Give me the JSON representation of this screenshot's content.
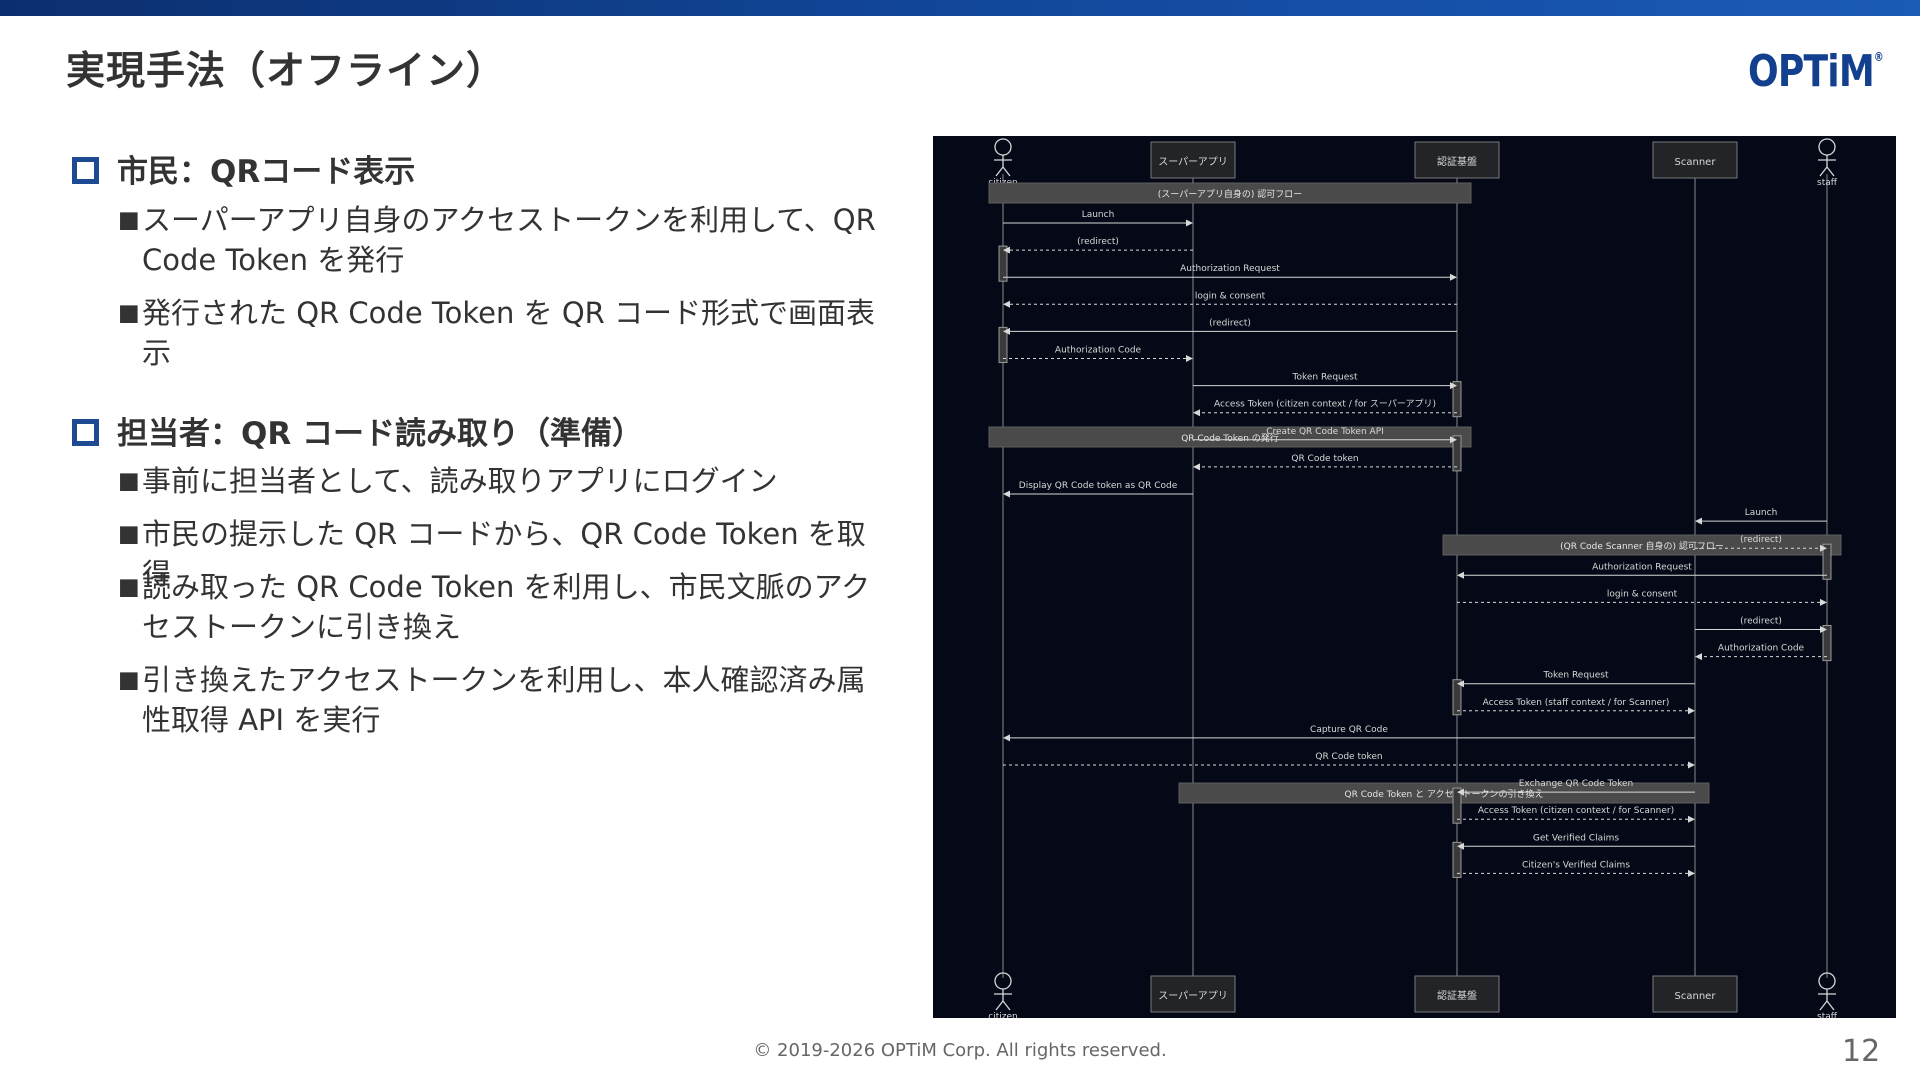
{
  "slide": {
    "title": "実現手法（オフライン）",
    "logo": "OPTiM",
    "logo_mark": "®",
    "footer": "© 2019-2026 OPTiM Corp. All rights reserved.",
    "page_number": "12",
    "accent_color": "#1d4a93"
  },
  "sections": [
    {
      "heading": "市民：QRコード表示",
      "bullets": [
        "スーパーアプリ自身のアクセストークンを利用して、QR Code Token を発行",
        "発行された QR Code Token を QR コード形式で画面表示"
      ]
    },
    {
      "heading": "担当者：QR コード読み取り（準備）",
      "bullets": [
        "事前に担当者として、読み取りアプリにログイン",
        "市民の提示した QR コードから、QR Code Token を取得",
        "読み取った QR Code Token を利用し、市民文脈のアクセストークンに引き換え",
        "引き換えたアクセストークンを利用し、本人確認済み属性取得 API を実行"
      ]
    }
  ],
  "diagram": {
    "participants": [
      {
        "key": "citizen",
        "label": "citizen",
        "kind": "actor"
      },
      {
        "key": "app",
        "label": "スーパーアプリ",
        "kind": "box"
      },
      {
        "key": "auth",
        "label": "認証基盤",
        "kind": "box"
      },
      {
        "key": "scanner",
        "label": "Scanner",
        "kind": "box"
      },
      {
        "key": "staff",
        "label": "staff",
        "kind": "actor"
      }
    ],
    "notes": [
      {
        "after": 0,
        "from": "citizen",
        "to": "auth",
        "label": "(スーパーアプリ自身の) 認可フロー"
      },
      {
        "after": 7,
        "from": "citizen",
        "to": "auth",
        "label": "QR Code Token の発行"
      },
      {
        "after": 10,
        "from": "auth",
        "to": "staff",
        "label": "(QR Code Scanner 自身の) 認可フロー"
      },
      {
        "after": 17,
        "from": "app",
        "to": "scanner",
        "label": "QR Code Token と アクセストークンの引き換え"
      }
    ],
    "messages": [
      {
        "from": "citizen",
        "to": "app",
        "label": "Launch",
        "dashed": false
      },
      {
        "from": "app",
        "to": "citizen",
        "label": "(redirect)",
        "dashed": true
      },
      {
        "from": "citizen",
        "to": "auth",
        "label": "Authorization Request",
        "dashed": false
      },
      {
        "from": "auth",
        "to": "citizen",
        "label": "login & consent",
        "dashed": true
      },
      {
        "from": "auth",
        "to": "citizen",
        "label": "(redirect)",
        "dashed": false
      },
      {
        "from": "citizen",
        "to": "app",
        "label": "Authorization Code",
        "dashed": true
      },
      {
        "from": "app",
        "to": "auth",
        "label": "Token Request",
        "dashed": false
      },
      {
        "from": "auth",
        "to": "app",
        "label": "Access Token (citizen context / for スーパーアプリ)",
        "dashed": true
      },
      {
        "from": "app",
        "to": "auth",
        "label": "Create QR Code Token API",
        "dashed": false
      },
      {
        "from": "auth",
        "to": "app",
        "label": "QR Code token",
        "dashed": true
      },
      {
        "from": "app",
        "to": "citizen",
        "label": "Display QR Code token as QR Code",
        "dashed": false
      },
      {
        "from": "staff",
        "to": "scanner",
        "label": "Launch",
        "dashed": false
      },
      {
        "from": "scanner",
        "to": "staff",
        "label": "(redirect)",
        "dashed": true
      },
      {
        "from": "staff",
        "to": "auth",
        "label": "Authorization Request",
        "dashed": false
      },
      {
        "from": "auth",
        "to": "staff",
        "label": "login & consent",
        "dashed": true
      },
      {
        "from": "scanner",
        "to": "staff",
        "label": "(redirect)",
        "dashed": false
      },
      {
        "from": "staff",
        "to": "scanner",
        "label": "Authorization Code",
        "dashed": true
      },
      {
        "from": "scanner",
        "to": "auth",
        "label": "Token Request",
        "dashed": false
      },
      {
        "from": "auth",
        "to": "scanner",
        "label": "Access Token (staff context / for Scanner)",
        "dashed": true
      },
      {
        "from": "scanner",
        "to": "citizen",
        "label": "Capture QR Code",
        "dashed": false
      },
      {
        "from": "citizen",
        "to": "scanner",
        "label": "QR Code token",
        "dashed": true
      },
      {
        "from": "scanner",
        "to": "auth",
        "label": "Exchange QR Code Token",
        "dashed": false
      },
      {
        "from": "auth",
        "to": "scanner",
        "label": "Access Token (citizen context / for Scanner)",
        "dashed": true
      },
      {
        "from": "scanner",
        "to": "auth",
        "label": "Get Verified Claims",
        "dashed": false
      },
      {
        "from": "auth",
        "to": "scanner",
        "label": "Citizen's Verified Claims",
        "dashed": true
      }
    ],
    "activations": [
      {
        "on": "citizen",
        "from_msg": 1,
        "to_msg": 2
      },
      {
        "on": "citizen",
        "from_msg": 4,
        "to_msg": 5
      },
      {
        "on": "auth",
        "from_msg": 6,
        "to_msg": 7
      },
      {
        "on": "auth",
        "from_msg": 8,
        "to_msg": 9
      },
      {
        "on": "staff",
        "from_msg": 12,
        "to_msg": 13
      },
      {
        "on": "staff",
        "from_msg": 15,
        "to_msg": 16
      },
      {
        "on": "auth",
        "from_msg": 17,
        "to_msg": 18
      },
      {
        "on": "auth",
        "from_msg": 21,
        "to_msg": 22
      },
      {
        "on": "auth",
        "from_msg": 23,
        "to_msg": 24
      }
    ]
  }
}
